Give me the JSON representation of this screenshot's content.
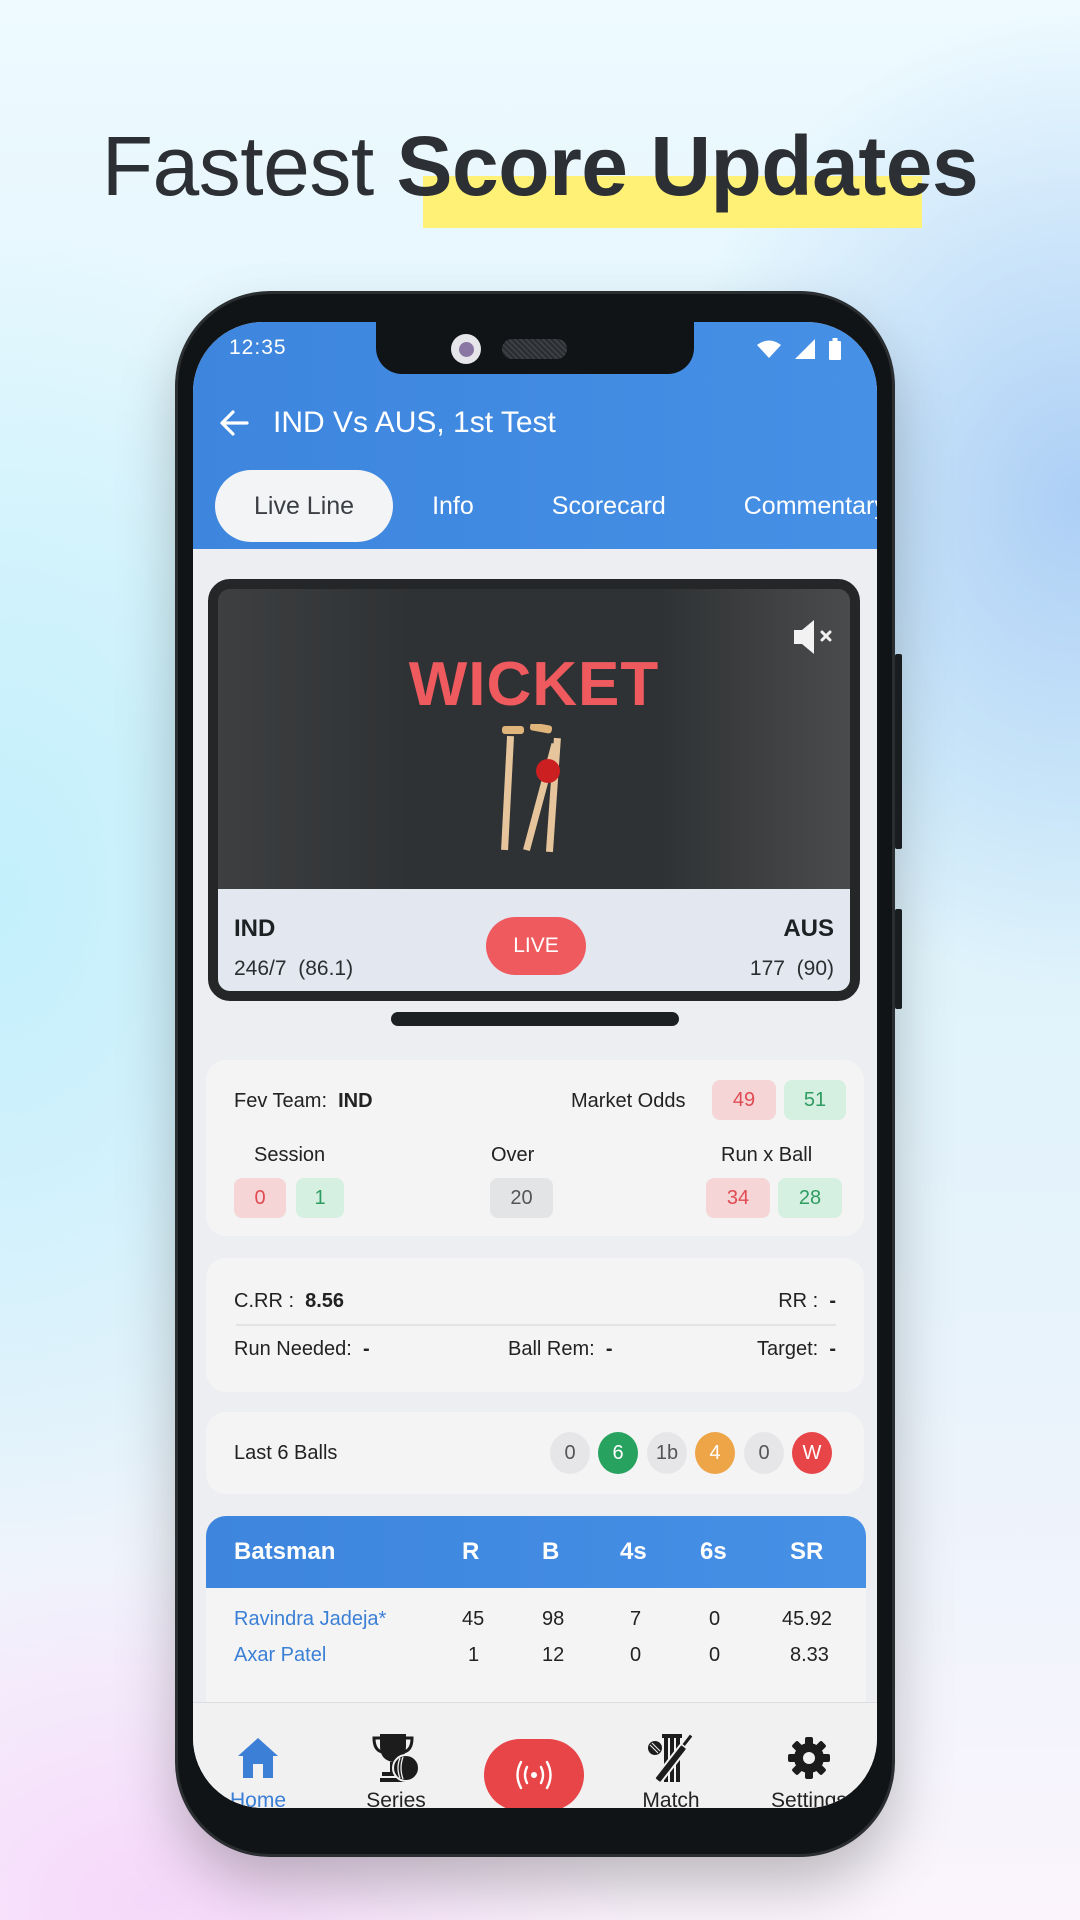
{
  "headline": {
    "light": "Fastest",
    "bold": "Score Updates"
  },
  "status_bar": {
    "time": "12:35",
    "icons": [
      "wifi-icon",
      "signal-icon",
      "battery-icon"
    ]
  },
  "header": {
    "title": "IND Vs AUS, 1st Test",
    "back_icon": "arrow-left-icon"
  },
  "tabs": [
    {
      "label": "Live Line",
      "active": true
    },
    {
      "label": "Info",
      "active": false
    },
    {
      "label": "Scorecard",
      "active": false
    },
    {
      "label": "Commentary",
      "active": false
    }
  ],
  "animation": {
    "event_text": "WICKET",
    "mute_icon": "speaker-muted-icon",
    "graphic": "broken-stumps-with-ball"
  },
  "scoreboard": {
    "team1": {
      "name": "IND",
      "score": "246/7",
      "overs": "(86.1)"
    },
    "team2": {
      "name": "AUS",
      "score": "177",
      "overs": "(90)"
    },
    "live_label": "LIVE"
  },
  "odds": {
    "fav_team_label": "Fev Team:",
    "fav_team_value": "IND",
    "market_odds_label": "Market Odds",
    "market_odds": {
      "back": "49",
      "lay": "51"
    },
    "session_label": "Session",
    "session": {
      "back": "0",
      "lay": "1"
    },
    "over_label": "Over",
    "over": "20",
    "run_x_ball_label": "Run x Ball",
    "run_x_ball": {
      "back": "34",
      "lay": "28"
    }
  },
  "rates": {
    "crr_label": "C.RR :",
    "crr_value": "8.56",
    "rr_label": "RR :",
    "rr_value": "-",
    "run_needed_label": "Run Needed:",
    "run_needed_value": "-",
    "ball_rem_label": "Ball Rem:",
    "ball_rem_value": "-",
    "target_label": "Target:",
    "target_value": "-"
  },
  "last_balls": {
    "label": "Last 6 Balls",
    "balls": [
      {
        "value": "0",
        "type": "dot"
      },
      {
        "value": "6",
        "type": "six"
      },
      {
        "value": "1b",
        "type": "dot"
      },
      {
        "value": "4",
        "type": "four"
      },
      {
        "value": "0",
        "type": "dot"
      },
      {
        "value": "W",
        "type": "wkt"
      }
    ]
  },
  "batsman_table": {
    "columns": [
      "Batsman",
      "R",
      "B",
      "4s",
      "6s",
      "SR"
    ],
    "rows": [
      {
        "name": "Ravindra Jadeja*",
        "r": "45",
        "b": "98",
        "fours": "7",
        "sixes": "0",
        "sr": "45.92"
      },
      {
        "name": "Axar Patel",
        "r": "1",
        "b": "12",
        "fours": "0",
        "sixes": "0",
        "sr": "8.33"
      }
    ]
  },
  "bottom_nav": [
    {
      "label": "Home",
      "icon": "home-icon",
      "active": true
    },
    {
      "label": "Series",
      "icon": "trophy-icon",
      "active": false
    },
    {
      "label": "",
      "icon": "live-broadcast-icon",
      "active": false
    },
    {
      "label": "Match",
      "icon": "cricket-bat-stumps-icon",
      "active": false
    },
    {
      "label": "Settings",
      "icon": "gear-icon",
      "active": false
    }
  ],
  "colors": {
    "primary_blue": "#3d85dd",
    "live_red": "#e84548",
    "wicket_red": "#ef5a5e",
    "highlight_yellow": "#fff176",
    "odds_red_bg": "#f6d5d7",
    "odds_green_bg": "#d5efe0"
  }
}
